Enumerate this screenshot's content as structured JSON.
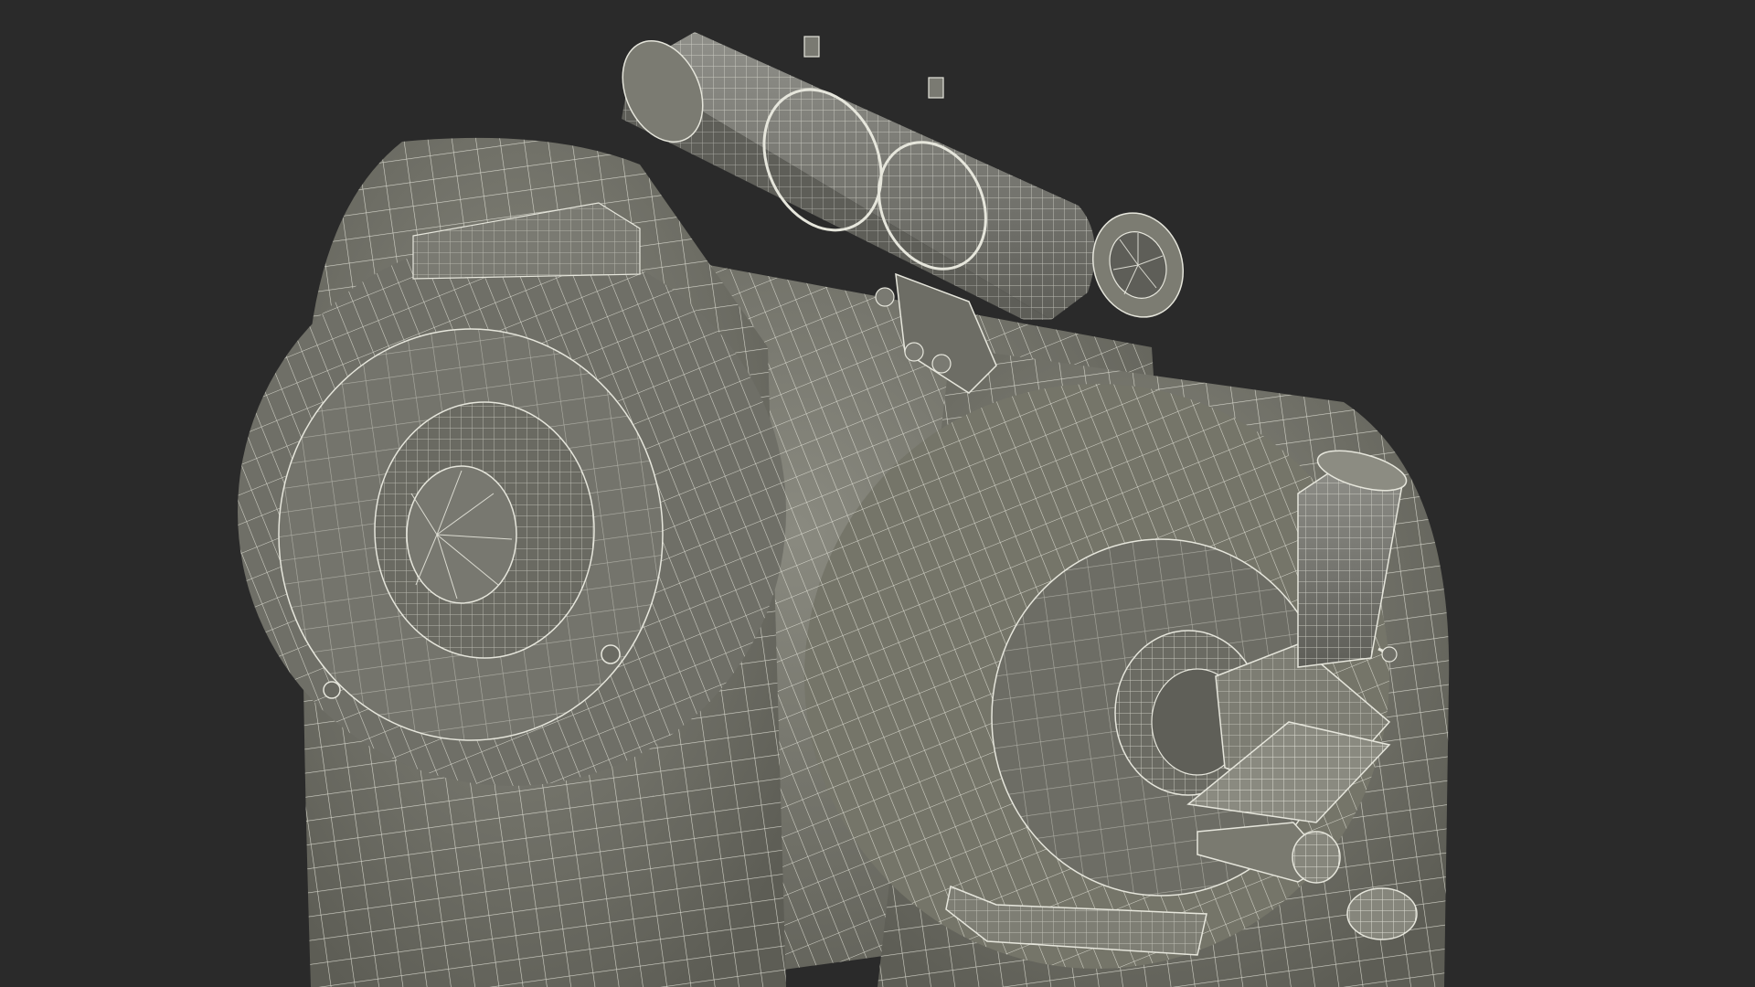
{
  "scene": {
    "subject": "telescope-wireframe-render",
    "background_color": "#2a2a2a",
    "surface_color": "#7c7c72",
    "surface_shadow_color": "#5f5f57",
    "surface_highlight_color": "#8e8e84",
    "wire_color": "#e6e6dc",
    "parts": [
      "fork-arm-wheel",
      "main-tube-barrel",
      "finder-scope",
      "finder-bracket",
      "rear-cell",
      "visual-back",
      "star-diagonal",
      "eyepiece",
      "focus-knob",
      "handle",
      "side-knob"
    ]
  }
}
